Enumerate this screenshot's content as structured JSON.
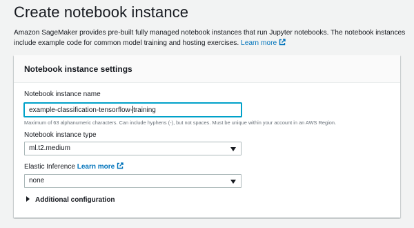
{
  "header": {
    "title": "Create notebook instance",
    "description": "Amazon SageMaker provides pre-built fully managed notebook instances that run Jupyter notebooks. The notebook instances include example code for common model training and hosting exercises.",
    "learn_more": "Learn more"
  },
  "settings": {
    "title": "Notebook instance settings",
    "name_label": "Notebook instance name",
    "name_value_before_caret": "example-classification-tensorflow-",
    "name_value_after_caret": "training",
    "name_hint": "Maximum of 63 alphanumeric characters. Can include hyphens (-), but not spaces. Must be unique within your account in an AWS Region.",
    "type_label": "Notebook instance type",
    "type_value": "ml.t2.medium",
    "elastic_label": "Elastic Inference",
    "elastic_learn_more": "Learn more",
    "elastic_value": "none",
    "additional_config": "Additional configuration"
  },
  "colors": {
    "link": "#0073bb",
    "focus": "#00a1c9",
    "background": "#f2f3f3"
  },
  "icons": {
    "external_link": "external-link-icon",
    "select_arrow": "caret-down-icon",
    "expander": "caret-right-icon"
  }
}
